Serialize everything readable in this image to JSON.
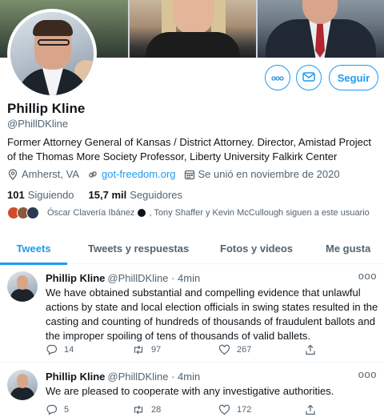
{
  "profile": {
    "name": "Phillip Kline",
    "handle": "@PhillDKline",
    "bio": "Former Attorney General of Kansas / District Attorney. Director, Amistad Project of the Thomas More Society Professor, Liberty University Falkirk Center",
    "location": "Amherst, VA",
    "website": "got-freedom.org",
    "joined": "Se unió en noviembre de 2020",
    "following_count": "101",
    "following_label": "Siguiendo",
    "followers_count": "15,7 mil",
    "followers_label": "Seguidores",
    "followed_by_prefix": "Óscar Clavería Ibánez",
    "followed_by_suffix": ", Tony Shaffer y Kevin McCullough siguen a este usuario"
  },
  "actions": {
    "follow_label": "Seguir",
    "more_label": "ooo"
  },
  "tabs": [
    {
      "label": "Tweets",
      "active": true
    },
    {
      "label": "Tweets y respuestas",
      "active": false
    },
    {
      "label": "Fotos y videos",
      "active": false
    },
    {
      "label": "Me gusta",
      "active": false
    }
  ],
  "tweets": [
    {
      "name": "Phillip Kline",
      "handle": "@PhillDKline · 4min",
      "more": "ooo",
      "text": "We have obtained substantial and compelling evidence that unlawful actions by state and local election officials in swing states resulted in the casting and counting of hundreds of thousands of fraudulent ballots and the improper spoiling of tens of thousands of valid ballets.",
      "replies": "14",
      "retweets": "97",
      "likes": "267"
    },
    {
      "name": "Phillip Kline",
      "handle": "@PhillDKline · 4min",
      "more": "ooo",
      "text": "We are pleased to cooperate with any investigative authorities.",
      "replies": "5",
      "retweets": "28",
      "likes": "172"
    }
  ],
  "colors": {
    "accent": "#1d9bf0",
    "text": "#0f1419",
    "muted": "#536471"
  }
}
